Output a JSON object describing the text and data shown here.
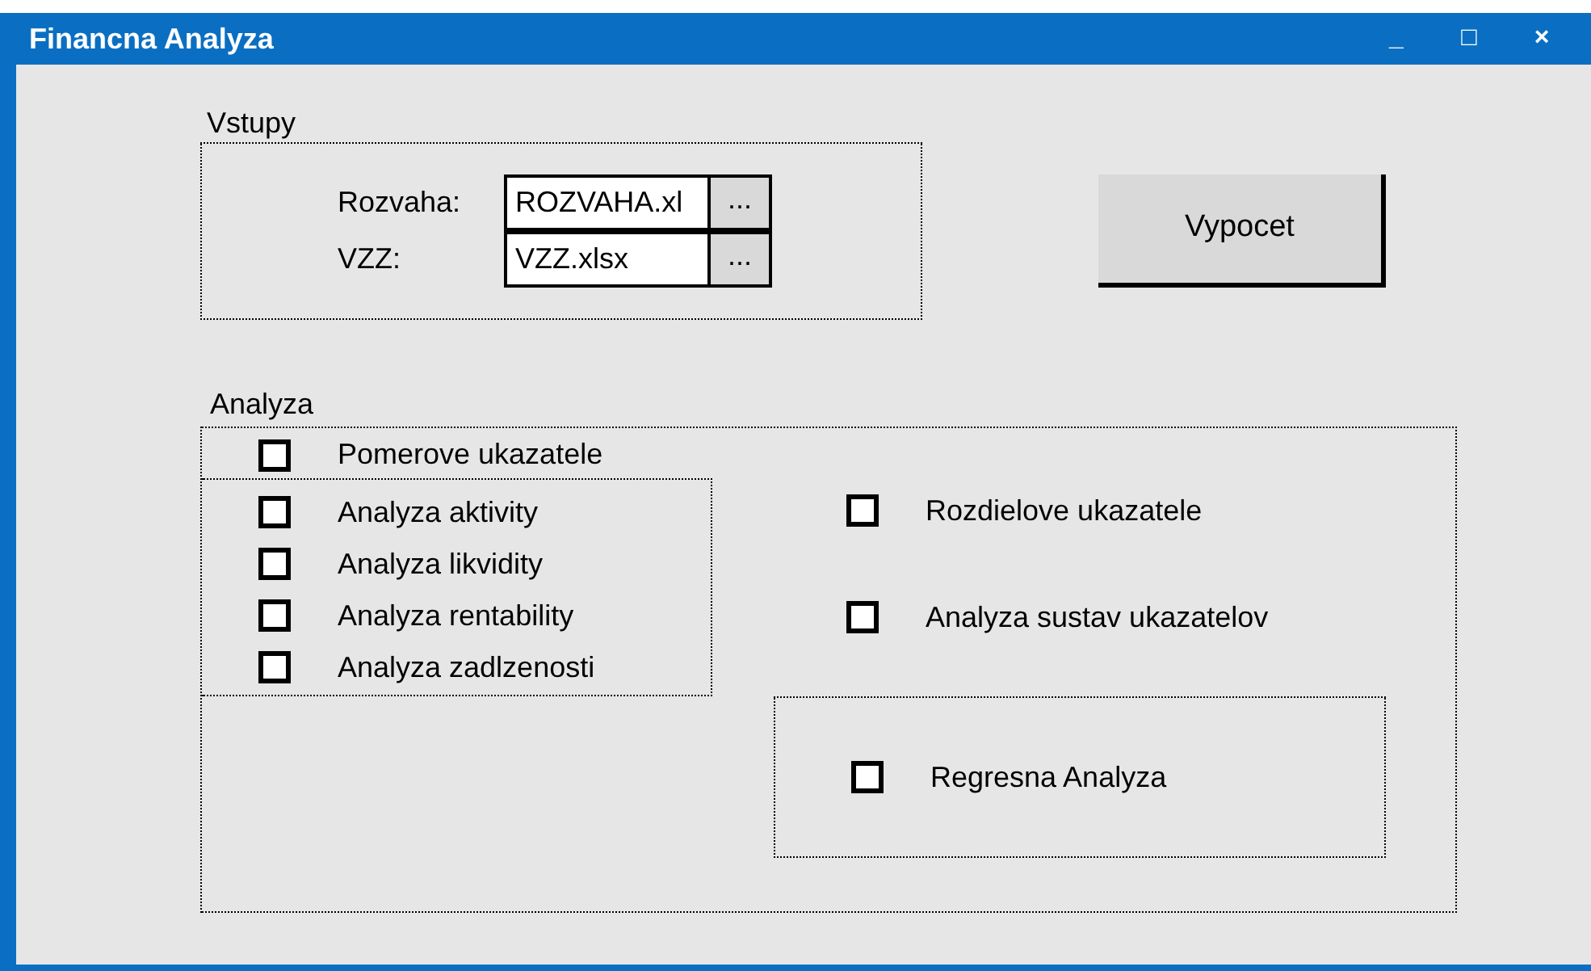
{
  "window": {
    "title": "Financna Analyza",
    "controls": [
      "_",
      "□",
      "×"
    ]
  },
  "inputs": {
    "label": "Vstupy",
    "files": [
      {
        "label": "Rozvaha:",
        "value": "ROZVAHA.xl",
        "browse": "..."
      },
      {
        "label": "VZZ:",
        "value": "VZZ.xlsx",
        "browse": "..."
      }
    ]
  },
  "calculate_button": "Vypocet",
  "analysis": {
    "label": "Analyza",
    "ratio": {
      "label": "Pomerove ukazatele",
      "checked": false
    },
    "ratio_items": [
      {
        "label": "Analyza aktivity",
        "checked": false
      },
      {
        "label": "Analyza likvidity",
        "checked": false
      },
      {
        "label": "Analyza rentability",
        "checked": false
      },
      {
        "label": "Analyza zadlzenosti",
        "checked": false
      }
    ],
    "other_items": [
      {
        "label": "Rozdielove ukazatele",
        "checked": false
      },
      {
        "label": "Analyza sustav ukazatelov",
        "checked": false
      }
    ],
    "regression": {
      "label": "Regresna Analyza",
      "checked": false
    }
  }
}
